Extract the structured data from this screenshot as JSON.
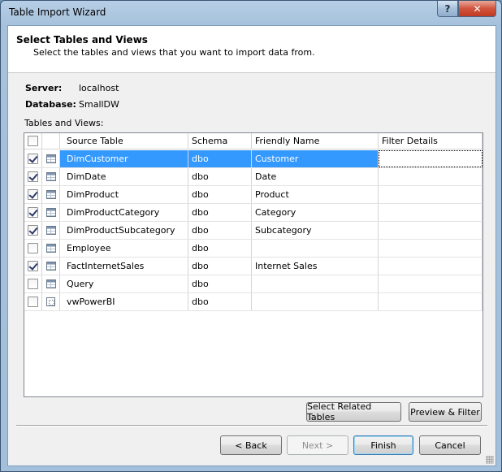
{
  "window": {
    "title": "Table Import Wizard",
    "help_glyph": "?",
    "close_glyph": "✕"
  },
  "header": {
    "title": "Select Tables and Views",
    "subtitle": "Select the tables and views that you want to import data from."
  },
  "connection": {
    "server_label": "Server:",
    "server_value": "localhost",
    "database_label": "Database:",
    "database_value": "SmallDW"
  },
  "grid": {
    "label": "Tables and Views:",
    "columns": [
      "",
      "",
      "Source Table",
      "Schema",
      "Friendly Name",
      "Filter Details"
    ],
    "rows": [
      {
        "checked": true,
        "icon": "table-icon",
        "source": "DimCustomer",
        "schema": "dbo",
        "friendly": "Customer",
        "filter": ""
      },
      {
        "checked": true,
        "icon": "table-icon",
        "source": "DimDate",
        "schema": "dbo",
        "friendly": "Date",
        "filter": ""
      },
      {
        "checked": true,
        "icon": "table-icon",
        "source": "DimProduct",
        "schema": "dbo",
        "friendly": "Product",
        "filter": ""
      },
      {
        "checked": true,
        "icon": "table-icon",
        "source": "DimProductCategory",
        "schema": "dbo",
        "friendly": "Category",
        "filter": ""
      },
      {
        "checked": true,
        "icon": "table-icon",
        "source": "DimProductSubcategory",
        "schema": "dbo",
        "friendly": "Subcategory",
        "filter": ""
      },
      {
        "checked": false,
        "icon": "table-icon",
        "source": "Employee",
        "schema": "dbo",
        "friendly": "",
        "filter": ""
      },
      {
        "checked": true,
        "icon": "table-icon",
        "source": "FactInternetSales",
        "schema": "dbo",
        "friendly": "Internet Sales",
        "filter": ""
      },
      {
        "checked": false,
        "icon": "table-icon",
        "source": "Query",
        "schema": "dbo",
        "friendly": "",
        "filter": ""
      },
      {
        "checked": false,
        "icon": "view-icon",
        "source": "vwPowerBI",
        "schema": "dbo",
        "friendly": "",
        "filter": ""
      }
    ]
  },
  "buttons": {
    "select_related": "Select Related Tables",
    "preview_filter": "Preview & Filter",
    "back": "< Back",
    "next": "Next >",
    "finish": "Finish",
    "cancel": "Cancel"
  }
}
